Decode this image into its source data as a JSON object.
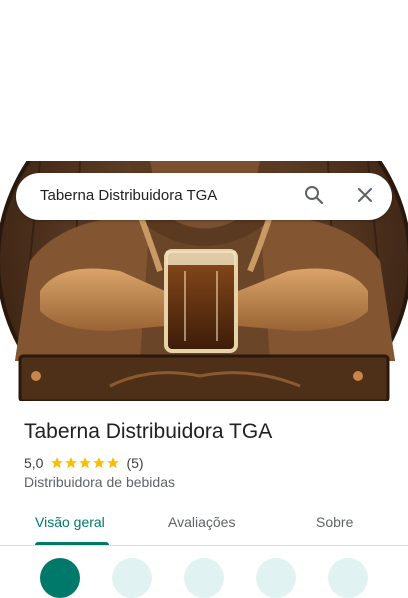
{
  "search": {
    "query": "Taberna Distribuidora TGA"
  },
  "place": {
    "name": "Taberna Distribuidora TGA",
    "rating": "5,0",
    "stars": 5,
    "review_count": "(5)",
    "category": "Distribuidora de bebidas"
  },
  "tabs": [
    {
      "label": "Visão geral",
      "active": true
    },
    {
      "label": "Avaliações",
      "active": false
    },
    {
      "label": "Sobre",
      "active": false
    }
  ],
  "colors": {
    "accent": "#00796b",
    "star": "#fbbc04",
    "text_primary": "#202124",
    "text_secondary": "#5f6368"
  },
  "icons": {
    "search": "search-icon",
    "close": "close-icon",
    "star": "star-icon"
  }
}
